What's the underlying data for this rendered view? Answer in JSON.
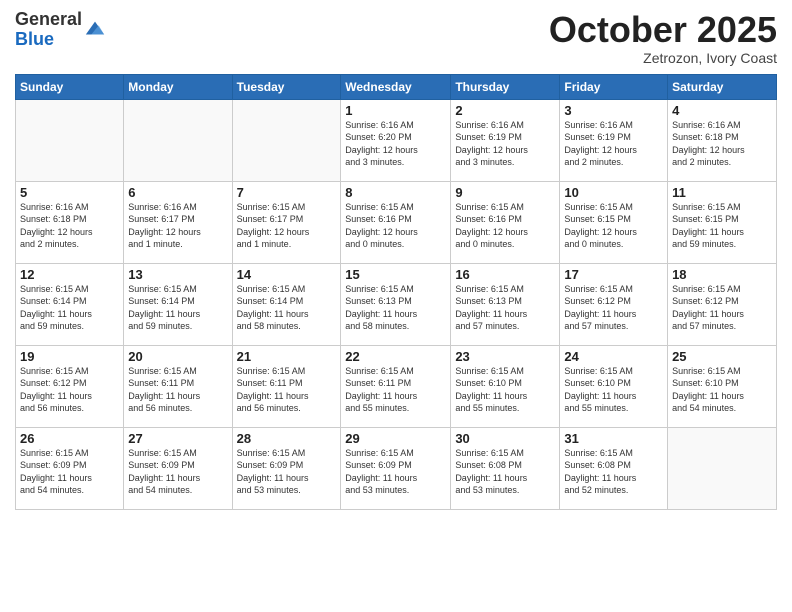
{
  "logo": {
    "line1": "General",
    "line2": "Blue"
  },
  "header": {
    "month": "October 2025",
    "location": "Zetrozon, Ivory Coast"
  },
  "weekdays": [
    "Sunday",
    "Monday",
    "Tuesday",
    "Wednesday",
    "Thursday",
    "Friday",
    "Saturday"
  ],
  "weeks": [
    [
      {
        "day": "",
        "info": ""
      },
      {
        "day": "",
        "info": ""
      },
      {
        "day": "",
        "info": ""
      },
      {
        "day": "1",
        "info": "Sunrise: 6:16 AM\nSunset: 6:20 PM\nDaylight: 12 hours\nand 3 minutes."
      },
      {
        "day": "2",
        "info": "Sunrise: 6:16 AM\nSunset: 6:19 PM\nDaylight: 12 hours\nand 3 minutes."
      },
      {
        "day": "3",
        "info": "Sunrise: 6:16 AM\nSunset: 6:19 PM\nDaylight: 12 hours\nand 2 minutes."
      },
      {
        "day": "4",
        "info": "Sunrise: 6:16 AM\nSunset: 6:18 PM\nDaylight: 12 hours\nand 2 minutes."
      }
    ],
    [
      {
        "day": "5",
        "info": "Sunrise: 6:16 AM\nSunset: 6:18 PM\nDaylight: 12 hours\nand 2 minutes."
      },
      {
        "day": "6",
        "info": "Sunrise: 6:16 AM\nSunset: 6:17 PM\nDaylight: 12 hours\nand 1 minute."
      },
      {
        "day": "7",
        "info": "Sunrise: 6:15 AM\nSunset: 6:17 PM\nDaylight: 12 hours\nand 1 minute."
      },
      {
        "day": "8",
        "info": "Sunrise: 6:15 AM\nSunset: 6:16 PM\nDaylight: 12 hours\nand 0 minutes."
      },
      {
        "day": "9",
        "info": "Sunrise: 6:15 AM\nSunset: 6:16 PM\nDaylight: 12 hours\nand 0 minutes."
      },
      {
        "day": "10",
        "info": "Sunrise: 6:15 AM\nSunset: 6:15 PM\nDaylight: 12 hours\nand 0 minutes."
      },
      {
        "day": "11",
        "info": "Sunrise: 6:15 AM\nSunset: 6:15 PM\nDaylight: 11 hours\nand 59 minutes."
      }
    ],
    [
      {
        "day": "12",
        "info": "Sunrise: 6:15 AM\nSunset: 6:14 PM\nDaylight: 11 hours\nand 59 minutes."
      },
      {
        "day": "13",
        "info": "Sunrise: 6:15 AM\nSunset: 6:14 PM\nDaylight: 11 hours\nand 59 minutes."
      },
      {
        "day": "14",
        "info": "Sunrise: 6:15 AM\nSunset: 6:14 PM\nDaylight: 11 hours\nand 58 minutes."
      },
      {
        "day": "15",
        "info": "Sunrise: 6:15 AM\nSunset: 6:13 PM\nDaylight: 11 hours\nand 58 minutes."
      },
      {
        "day": "16",
        "info": "Sunrise: 6:15 AM\nSunset: 6:13 PM\nDaylight: 11 hours\nand 57 minutes."
      },
      {
        "day": "17",
        "info": "Sunrise: 6:15 AM\nSunset: 6:12 PM\nDaylight: 11 hours\nand 57 minutes."
      },
      {
        "day": "18",
        "info": "Sunrise: 6:15 AM\nSunset: 6:12 PM\nDaylight: 11 hours\nand 57 minutes."
      }
    ],
    [
      {
        "day": "19",
        "info": "Sunrise: 6:15 AM\nSunset: 6:12 PM\nDaylight: 11 hours\nand 56 minutes."
      },
      {
        "day": "20",
        "info": "Sunrise: 6:15 AM\nSunset: 6:11 PM\nDaylight: 11 hours\nand 56 minutes."
      },
      {
        "day": "21",
        "info": "Sunrise: 6:15 AM\nSunset: 6:11 PM\nDaylight: 11 hours\nand 56 minutes."
      },
      {
        "day": "22",
        "info": "Sunrise: 6:15 AM\nSunset: 6:11 PM\nDaylight: 11 hours\nand 55 minutes."
      },
      {
        "day": "23",
        "info": "Sunrise: 6:15 AM\nSunset: 6:10 PM\nDaylight: 11 hours\nand 55 minutes."
      },
      {
        "day": "24",
        "info": "Sunrise: 6:15 AM\nSunset: 6:10 PM\nDaylight: 11 hours\nand 55 minutes."
      },
      {
        "day": "25",
        "info": "Sunrise: 6:15 AM\nSunset: 6:10 PM\nDaylight: 11 hours\nand 54 minutes."
      }
    ],
    [
      {
        "day": "26",
        "info": "Sunrise: 6:15 AM\nSunset: 6:09 PM\nDaylight: 11 hours\nand 54 minutes."
      },
      {
        "day": "27",
        "info": "Sunrise: 6:15 AM\nSunset: 6:09 PM\nDaylight: 11 hours\nand 54 minutes."
      },
      {
        "day": "28",
        "info": "Sunrise: 6:15 AM\nSunset: 6:09 PM\nDaylight: 11 hours\nand 53 minutes."
      },
      {
        "day": "29",
        "info": "Sunrise: 6:15 AM\nSunset: 6:09 PM\nDaylight: 11 hours\nand 53 minutes."
      },
      {
        "day": "30",
        "info": "Sunrise: 6:15 AM\nSunset: 6:08 PM\nDaylight: 11 hours\nand 53 minutes."
      },
      {
        "day": "31",
        "info": "Sunrise: 6:15 AM\nSunset: 6:08 PM\nDaylight: 11 hours\nand 52 minutes."
      },
      {
        "day": "",
        "info": ""
      }
    ]
  ]
}
